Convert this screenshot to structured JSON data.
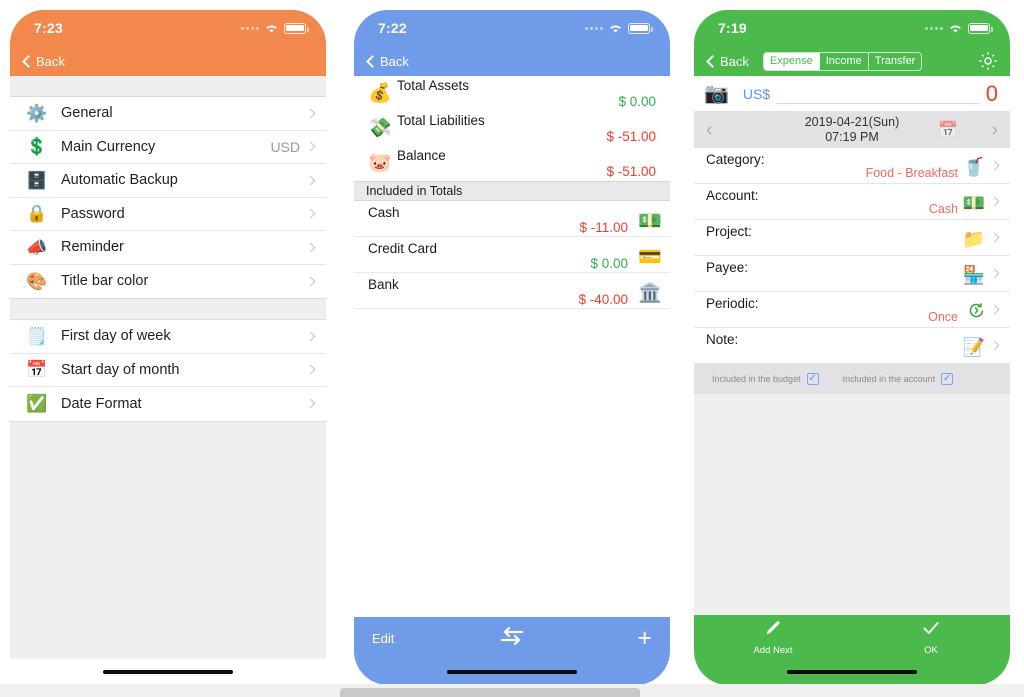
{
  "screens": [
    {
      "id": "settings",
      "accent": "#F2884B",
      "statusbar": {
        "time": "7:23",
        "wifi_icon": "wifi-icon",
        "battery_icon": "battery-icon",
        "signal_icon": "signal-dots-icon"
      },
      "nav": {
        "back_label": "Back",
        "back_icon": "chevron-left-icon"
      },
      "groups": [
        {
          "rows": [
            {
              "icon": "gears-icon",
              "emoji": "⚙️",
              "label": "General",
              "value": ""
            },
            {
              "icon": "dollar-coin-icon",
              "emoji": "💲",
              "label": "Main Currency",
              "value": "USD"
            },
            {
              "icon": "backup-icon",
              "emoji": "🗄️",
              "label": "Automatic Backup",
              "value": ""
            },
            {
              "icon": "lock-icon",
              "emoji": "🔒",
              "label": "Password",
              "value": ""
            },
            {
              "icon": "megaphone-icon",
              "emoji": "📣",
              "label": "Reminder",
              "value": ""
            },
            {
              "icon": "palette-icon",
              "emoji": "🎨",
              "label": "Title bar color",
              "value": ""
            }
          ]
        },
        {
          "rows": [
            {
              "icon": "list-icon",
              "emoji": "🗒️",
              "label": "First day of week",
              "value": ""
            },
            {
              "icon": "calendar-icon",
              "emoji": "📅",
              "label": "Start day of month",
              "value": ""
            },
            {
              "icon": "check-calendar-icon",
              "emoji": "✅",
              "label": "Date Format",
              "value": ""
            }
          ]
        }
      ]
    },
    {
      "id": "accounts",
      "accent": "#6F9BE8",
      "statusbar": {
        "time": "7:22"
      },
      "nav": {
        "back_label": "Back",
        "back_icon": "chevron-left-icon"
      },
      "totals": [
        {
          "emoji": "💰",
          "icon": "gold-bars-icon",
          "label": "Total Assets",
          "amount": "$ 0.00",
          "sign": "pos"
        },
        {
          "emoji": "💸",
          "icon": "money-scissors-icon",
          "label": "Total Liabilities",
          "amount": "$ -51.00",
          "sign": "neg"
        },
        {
          "emoji": "🐷",
          "icon": "piggy-bank-icon",
          "label": "Balance",
          "amount": "$ -51.00",
          "sign": "neg"
        }
      ],
      "section_header": "Included in Totals",
      "accounts": [
        {
          "label": "Cash",
          "amount": "$ -11.00",
          "sign": "neg",
          "emoji": "💵",
          "icon": "cash-icon"
        },
        {
          "label": "Credit Card",
          "amount": "$ 0.00",
          "sign": "pos",
          "emoji": "💳",
          "icon": "credit-card-icon"
        },
        {
          "label": "Bank",
          "amount": "$ -40.00",
          "sign": "neg",
          "emoji": "🏛️",
          "icon": "bank-icon"
        }
      ],
      "toolbar": {
        "edit_label": "Edit",
        "transfer_icon": "transfer-arrows-icon",
        "add_label": "+"
      }
    },
    {
      "id": "new-record",
      "accent": "#4CB94C",
      "statusbar": {
        "time": "7:19"
      },
      "nav": {
        "back_label": "Back",
        "back_icon": "chevron-left-icon",
        "gear_icon": "gear-icon"
      },
      "segments": [
        {
          "label": "Expense",
          "selected": true
        },
        {
          "label": "Income",
          "selected": false
        },
        {
          "label": "Transfer",
          "selected": false
        }
      ],
      "amount_row": {
        "camera_icon": "folder-camera-icon",
        "camera_emoji": "📷",
        "currency": "US$",
        "amount": "0"
      },
      "date_row": {
        "prev_icon": "chevron-left-icon",
        "next_icon": "chevron-right-icon",
        "date": "2019-04-21(Sun)",
        "time": "07:19 PM",
        "calendar_icon": "calendar-picker-icon"
      },
      "fields": [
        {
          "label": "Category:",
          "value": "Food - Breakfast",
          "emoji": "🥤",
          "icon": "drink-icon"
        },
        {
          "label": "Account:",
          "value": "Cash",
          "emoji": "💵",
          "icon": "cash-icon"
        },
        {
          "label": "Project:",
          "value": "",
          "emoji": "📁",
          "icon": "folder-icon"
        },
        {
          "label": "Payee:",
          "value": "",
          "emoji": "🏪",
          "icon": "store-icon"
        },
        {
          "label": "Periodic:",
          "value": "Once",
          "emoji": "🕛",
          "icon": "repeat-clock-icon"
        },
        {
          "label": "Note:",
          "value": "",
          "emoji": "📝",
          "icon": "note-pencil-icon"
        }
      ],
      "checkboxes": [
        {
          "label": "Included in the budget",
          "checked": true
        },
        {
          "label": "Included in the account",
          "checked": true
        }
      ],
      "toolbar": [
        {
          "label": "Add Next",
          "icon": "pencil-icon"
        },
        {
          "label": "OK",
          "icon": "check-icon"
        }
      ]
    }
  ]
}
